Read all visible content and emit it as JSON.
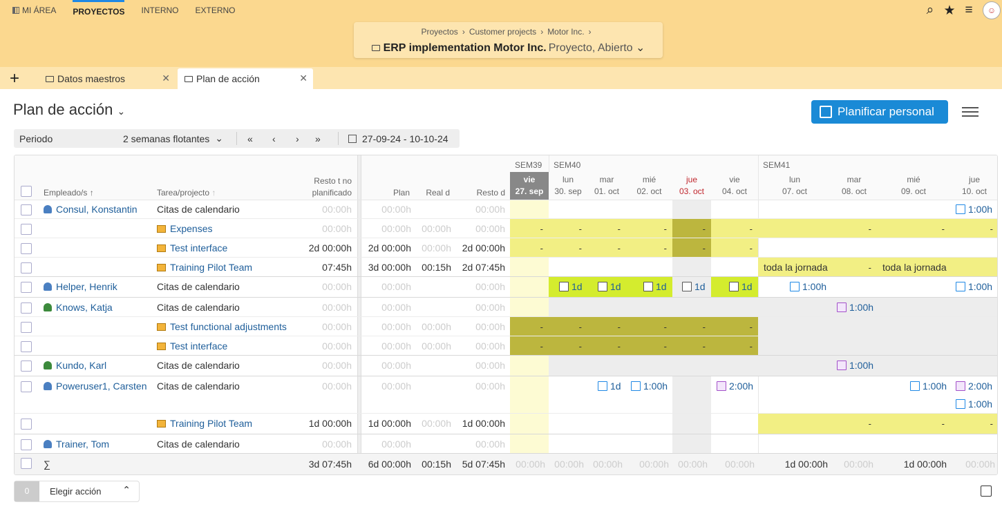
{
  "nav": {
    "my_area": "MI ÁREA",
    "projects": "PROYECTOS",
    "internal": "INTERNO",
    "external": "EXTERNO"
  },
  "breadcrumb": {
    "b1": "Proyectos",
    "b2": "Customer projects",
    "b3": "Motor Inc.",
    "sep": "›"
  },
  "project": {
    "title": "ERP implementation Motor Inc.",
    "subtitle": "Proyecto, Abierto"
  },
  "tabs": [
    {
      "label": "Datos maestros"
    },
    {
      "label": "Plan de acción"
    }
  ],
  "page": {
    "title": "Plan de acción",
    "plan_button": "Planificar personal"
  },
  "toolbar": {
    "period_label": "Periodo",
    "period_value": "2 semanas flotantes",
    "date_range": "27-09-24 - 10-10-24"
  },
  "grid": {
    "headers": {
      "employee": "Empleado/s",
      "task": "Tarea/projecto",
      "resto_t1": "Resto t no",
      "resto_t2": "planificado",
      "plan": "Plan",
      "real": "Real d",
      "resto_d": "Resto d"
    },
    "weeks": [
      "SEM39",
      "SEM40",
      "SEM41"
    ],
    "days": [
      {
        "wd": "vie",
        "d": "27. sep"
      },
      {
        "wd": "lun",
        "d": "30. sep"
      },
      {
        "wd": "mar",
        "d": "01. oct"
      },
      {
        "wd": "mié",
        "d": "02. oct"
      },
      {
        "wd": "jue",
        "d": "03. oct"
      },
      {
        "wd": "vie",
        "d": "04. oct"
      },
      {
        "wd": "lun",
        "d": "07. oct"
      },
      {
        "wd": "mar",
        "d": "08. oct"
      },
      {
        "wd": "mié",
        "d": "09. oct"
      },
      {
        "wd": "jue",
        "d": "10. oct"
      }
    ],
    "rows": [
      {
        "emp": "Consul, Konstantin",
        "task": "Citas de calendario",
        "r1": "00:00h",
        "plan": "00:00h",
        "real": "",
        "resto": "00:00h"
      },
      {
        "task": "Expenses",
        "r1": "00:00h",
        "plan": "00:00h",
        "real": "00:00h",
        "resto": "00:00h"
      },
      {
        "task": "Test interface",
        "r1": "2d 00:00h",
        "plan": "2d 00:00h",
        "real": "00:00h",
        "resto": "2d 00:00h"
      },
      {
        "task": "Training Pilot Team",
        "r1": "07:45h",
        "plan": "3d 00:00h",
        "real": "00:15h",
        "resto": "2d 07:45h"
      },
      {
        "emp": "Helper, Henrik",
        "task": "Citas de calendario",
        "r1": "00:00h",
        "plan": "00:00h",
        "real": "",
        "resto": "00:00h"
      },
      {
        "emp": "Knows, Katja",
        "task": "Citas de calendario",
        "r1": "00:00h",
        "plan": "00:00h",
        "real": "",
        "resto": "00:00h"
      },
      {
        "task": "Test functional adjustments",
        "r1": "00:00h",
        "plan": "00:00h",
        "real": "00:00h",
        "resto": "00:00h"
      },
      {
        "task": "Test interface",
        "r1": "00:00h",
        "plan": "00:00h",
        "real": "00:00h",
        "resto": "00:00h"
      },
      {
        "emp": "Kundo, Karl",
        "task": "Citas de calendario",
        "r1": "00:00h",
        "plan": "00:00h",
        "real": "",
        "resto": "00:00h"
      },
      {
        "emp": "Poweruser1, Carsten",
        "task": "Citas de calendario",
        "r1": "00:00h",
        "plan": "00:00h",
        "real": "",
        "resto": "00:00h"
      },
      {
        "task": "Training Pilot Team",
        "r1": "1d 00:00h",
        "plan": "1d 00:00h",
        "real": "00:00h",
        "resto": "1d 00:00h"
      },
      {
        "emp": "Trainer, Tom",
        "task": "Citas de calendario",
        "r1": "00:00h",
        "plan": "00:00h",
        "real": "",
        "resto": "00:00h"
      }
    ],
    "sum": {
      "label": "∑",
      "r1": "3d 07:45h",
      "plan": "6d 00:00h",
      "real": "00:15h",
      "resto": "5d 07:45h",
      "days": [
        "00:00h",
        "00:00h",
        "00:00h",
        "00:00h",
        "00:00h",
        "00:00h",
        "1d 00:00h",
        "00:00h",
        "1d 00:00h",
        "00:00h"
      ]
    },
    "full_day": "toda la jornada",
    "dash": "-",
    "events": {
      "e1": "1:00h",
      "e1d": "1d",
      "e200": "2:00h"
    }
  },
  "bottom": {
    "count": "0",
    "action": "Elegir acción"
  },
  "icons": {
    "search": "search-icon",
    "star": "star-icon",
    "menu": "menu-icon"
  }
}
